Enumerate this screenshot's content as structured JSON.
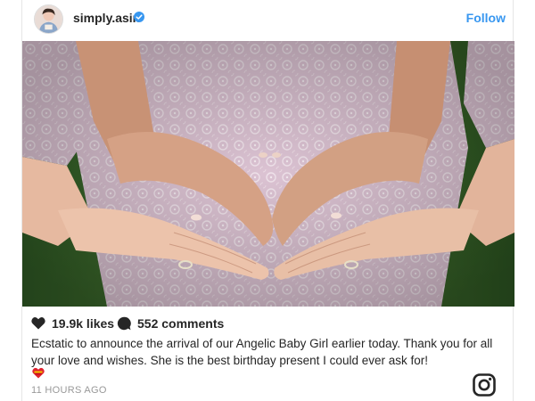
{
  "post": {
    "username": "simply.asin",
    "verified": true,
    "follow_label": "Follow",
    "likes": "19.9k likes",
    "comments": "552 comments",
    "caption": "Ecstatic to announce the arrival of our Angelic Baby Girl earlier today. Thank you for all your love and wishes. She is the best birthday present I could ever ask for!",
    "timestamp": "11 HOURS AGO"
  },
  "icons": {
    "avatar": "avatar",
    "verified": "verified-badge-icon",
    "like": "heart-icon",
    "comment": "comment-bubble-icon",
    "emoji": "heart-emoji-icon",
    "brand": "instagram-logo-icon"
  },
  "colors": {
    "link_blue": "#3897f0",
    "text": "#262626",
    "muted": "#999999",
    "emoji_red": "#e0232e"
  }
}
